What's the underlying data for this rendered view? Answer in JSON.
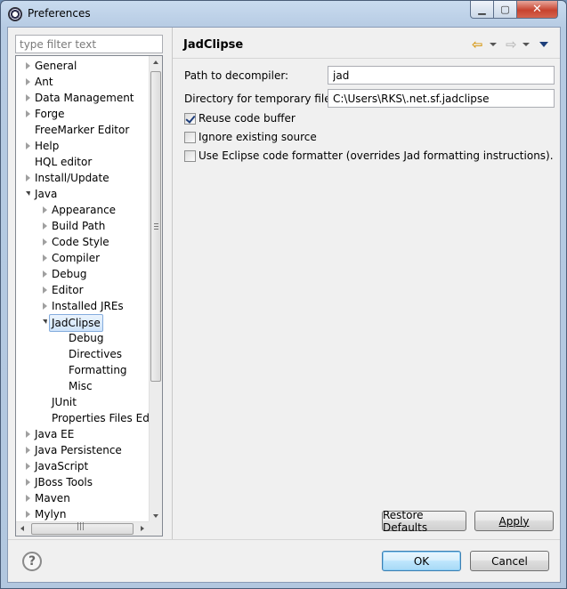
{
  "window": {
    "title": "Preferences"
  },
  "titlebar_buttons": {
    "minimize": "▁",
    "maximize": "▢",
    "close": "✕"
  },
  "filter": {
    "placeholder": "type filter text"
  },
  "tree": [
    {
      "label": "General",
      "level": 0,
      "state": "collapsed"
    },
    {
      "label": "Ant",
      "level": 0,
      "state": "collapsed"
    },
    {
      "label": "Data Management",
      "level": 0,
      "state": "collapsed"
    },
    {
      "label": "Forge",
      "level": 0,
      "state": "collapsed"
    },
    {
      "label": "FreeMarker Editor",
      "level": 0,
      "state": "leaf"
    },
    {
      "label": "Help",
      "level": 0,
      "state": "collapsed"
    },
    {
      "label": "HQL editor",
      "level": 0,
      "state": "leaf"
    },
    {
      "label": "Install/Update",
      "level": 0,
      "state": "collapsed"
    },
    {
      "label": "Java",
      "level": 0,
      "state": "expanded"
    },
    {
      "label": "Appearance",
      "level": 1,
      "state": "collapsed"
    },
    {
      "label": "Build Path",
      "level": 1,
      "state": "collapsed"
    },
    {
      "label": "Code Style",
      "level": 1,
      "state": "collapsed"
    },
    {
      "label": "Compiler",
      "level": 1,
      "state": "collapsed"
    },
    {
      "label": "Debug",
      "level": 1,
      "state": "collapsed"
    },
    {
      "label": "Editor",
      "level": 1,
      "state": "collapsed"
    },
    {
      "label": "Installed JREs",
      "level": 1,
      "state": "collapsed"
    },
    {
      "label": "JadClipse",
      "level": 1,
      "state": "expanded",
      "selected": true
    },
    {
      "label": "Debug",
      "level": 2,
      "state": "leaf"
    },
    {
      "label": "Directives",
      "level": 2,
      "state": "leaf"
    },
    {
      "label": "Formatting",
      "level": 2,
      "state": "leaf"
    },
    {
      "label": "Misc",
      "level": 2,
      "state": "leaf"
    },
    {
      "label": "JUnit",
      "level": 1,
      "state": "leaf"
    },
    {
      "label": "Properties Files Edito",
      "level": 1,
      "state": "leaf"
    },
    {
      "label": "Java EE",
      "level": 0,
      "state": "collapsed"
    },
    {
      "label": "Java Persistence",
      "level": 0,
      "state": "collapsed"
    },
    {
      "label": "JavaScript",
      "level": 0,
      "state": "collapsed"
    },
    {
      "label": "JBoss Tools",
      "level": 0,
      "state": "collapsed"
    },
    {
      "label": "Maven",
      "level": 0,
      "state": "collapsed"
    },
    {
      "label": "Mylyn",
      "level": 0,
      "state": "collapsed"
    }
  ],
  "scrollbar_grip": "|||",
  "page": {
    "title": "JadClipse",
    "decompiler_label": "Path to decompiler:",
    "decompiler_value": "jad",
    "tempdir_label": "Directory for temporary files:",
    "tempdir_value": "C:\\Users\\RKS\\.net.sf.jadclipse",
    "options": [
      {
        "label": "Reuse code buffer",
        "checked": true
      },
      {
        "label": "Ignore existing source",
        "checked": false
      },
      {
        "label": "Use Eclipse code formatter (overrides Jad formatting instructions).",
        "checked": false
      }
    ]
  },
  "icons": {
    "back": "⇦",
    "forward": "⇨",
    "help": "?"
  },
  "buttons": {
    "restore_defaults": "Restore Defaults",
    "apply": "Apply",
    "ok": "OK",
    "cancel": "Cancel"
  }
}
